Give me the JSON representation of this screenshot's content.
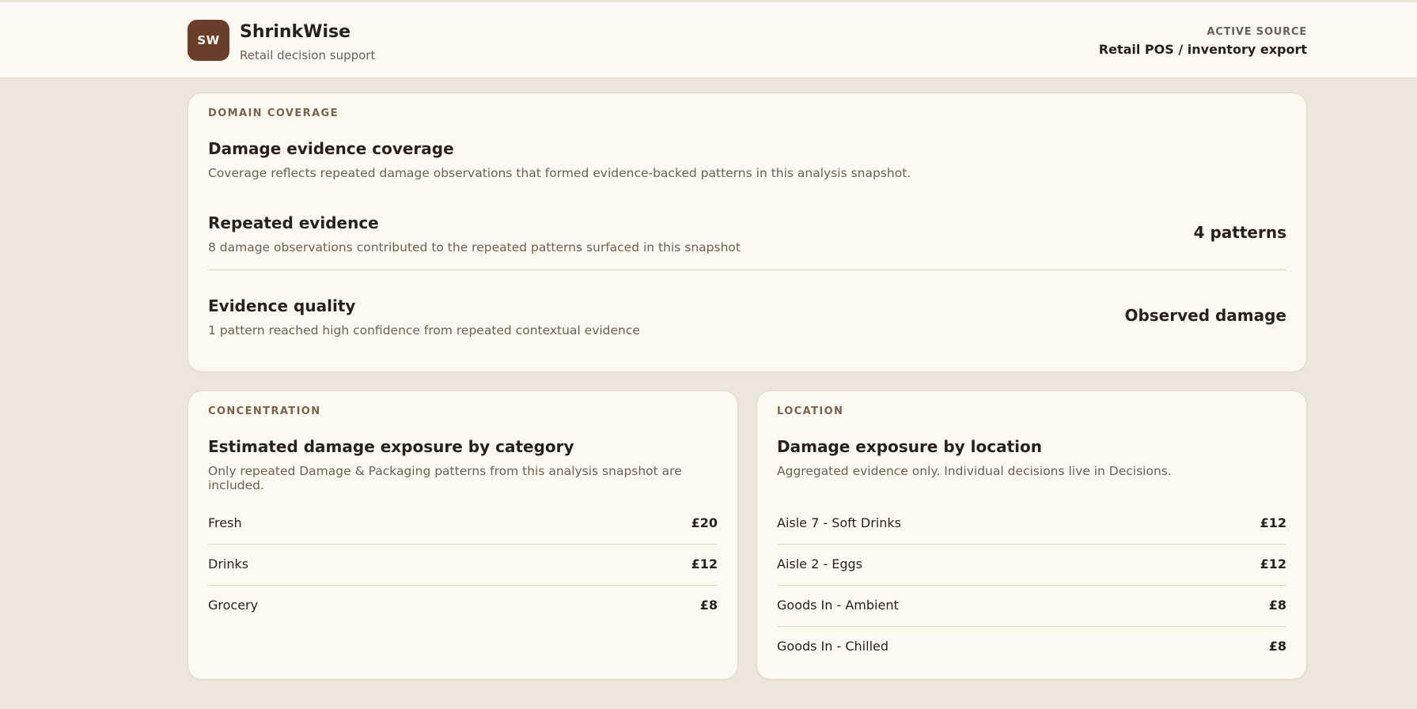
{
  "header": {
    "logo_text": "SW",
    "brand_name": "ShrinkWise",
    "brand_tagline": "Retail decision support",
    "source_label": "ACTIVE SOURCE",
    "source_value": "Retail POS / inventory export"
  },
  "coverage": {
    "kicker": "DOMAIN COVERAGE",
    "title": "Damage evidence coverage",
    "description": "Coverage reflects repeated damage observations that formed evidence-backed patterns in this analysis snapshot.",
    "metrics": [
      {
        "title": "Repeated evidence",
        "subtitle": "8 damage observations contributed to the repeated patterns surfaced in this snapshot",
        "value": "4 patterns"
      },
      {
        "title": "Evidence quality",
        "subtitle": "1 pattern reached high confidence from repeated contextual evidence",
        "value": "Observed damage"
      }
    ]
  },
  "category": {
    "kicker": "CONCENTRATION",
    "title": "Estimated damage exposure by category",
    "description": "Only repeated Damage & Packaging patterns from this analysis snapshot are included.",
    "items": [
      {
        "label": "Fresh",
        "value": "£20"
      },
      {
        "label": "Drinks",
        "value": "£12"
      },
      {
        "label": "Grocery",
        "value": "£8"
      }
    ]
  },
  "location": {
    "kicker": "LOCATION",
    "title": "Damage exposure by location",
    "description": "Aggregated evidence only. Individual decisions live in Decisions.",
    "items": [
      {
        "label": "Aisle 7 - Soft Drinks",
        "value": "£12"
      },
      {
        "label": "Aisle 2 - Eggs",
        "value": "£12"
      },
      {
        "label": "Goods In - Ambient",
        "value": "£8"
      },
      {
        "label": "Goods In - Chilled",
        "value": "£8"
      }
    ]
  },
  "colors": {
    "page_bg": "#efe6db",
    "card_bg": "#fdf9f1",
    "brand": "#6b3e2c",
    "text": "#2a1f1a",
    "muted": "#6d5f56"
  }
}
